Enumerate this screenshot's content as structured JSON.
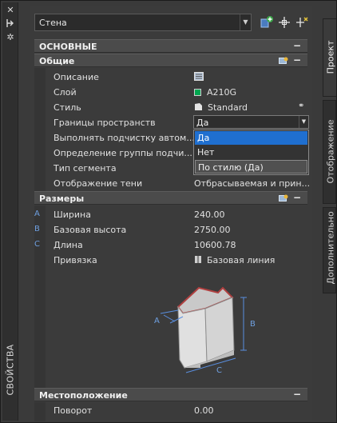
{
  "palette": {
    "frame": "#3a3a3a",
    "section": "#4b4b4b",
    "selection": "#1f6fd0",
    "layer_color": "#00a650",
    "dim_blue": "#6fa0e0"
  },
  "left_strip": {
    "title": "СВОЙСТВА",
    "icons": [
      "close-icon",
      "autohide-icon",
      "gear-icon"
    ]
  },
  "toolbar": {
    "object_type": "Стена",
    "buttons": [
      "add-to-set-icon",
      "select-objects-icon",
      "quick-select-icon"
    ]
  },
  "tabs": [
    {
      "label": "Проект",
      "active": true
    },
    {
      "label": "Отображение",
      "active": false
    },
    {
      "label": "Дополнительно",
      "active": false
    }
  ],
  "sections": {
    "basic": "ОСНОВНЫЕ",
    "general": "Общие",
    "dimensions": "Размеры",
    "location": "Местоположение"
  },
  "general_rows": [
    {
      "label": "Описание",
      "value": ""
    },
    {
      "label": "Слой",
      "value": "A210G"
    },
    {
      "label": "Стиль",
      "value": "Standard"
    },
    {
      "label": "Границы пространств",
      "value": "Да"
    },
    {
      "label": "Выполнять подчистку автом...",
      "value": ""
    },
    {
      "label": "Определение группы подчи...",
      "value": ""
    },
    {
      "label": "Тип сегмента",
      "value": ""
    },
    {
      "label": "Отображение тени",
      "value": "Отбрасываемая и прин..."
    }
  ],
  "dropdown": {
    "options": [
      "Да",
      "Нет",
      "По стилю (Да)"
    ],
    "selected": "Да"
  },
  "dimension_rows": [
    {
      "letter": "A",
      "label": "Ширина",
      "value": "240.00"
    },
    {
      "letter": "B",
      "label": "Базовая высота",
      "value": "2750.00"
    },
    {
      "letter": "C",
      "label": "Длина",
      "value": "10600.78"
    },
    {
      "letter": "",
      "label": "Привязка",
      "value": "Базовая линия"
    }
  ],
  "illustration_labels": {
    "a": "A",
    "b": "B",
    "c": "C"
  },
  "location_rows": [
    {
      "label": "Поворот",
      "value": "0.00"
    }
  ]
}
